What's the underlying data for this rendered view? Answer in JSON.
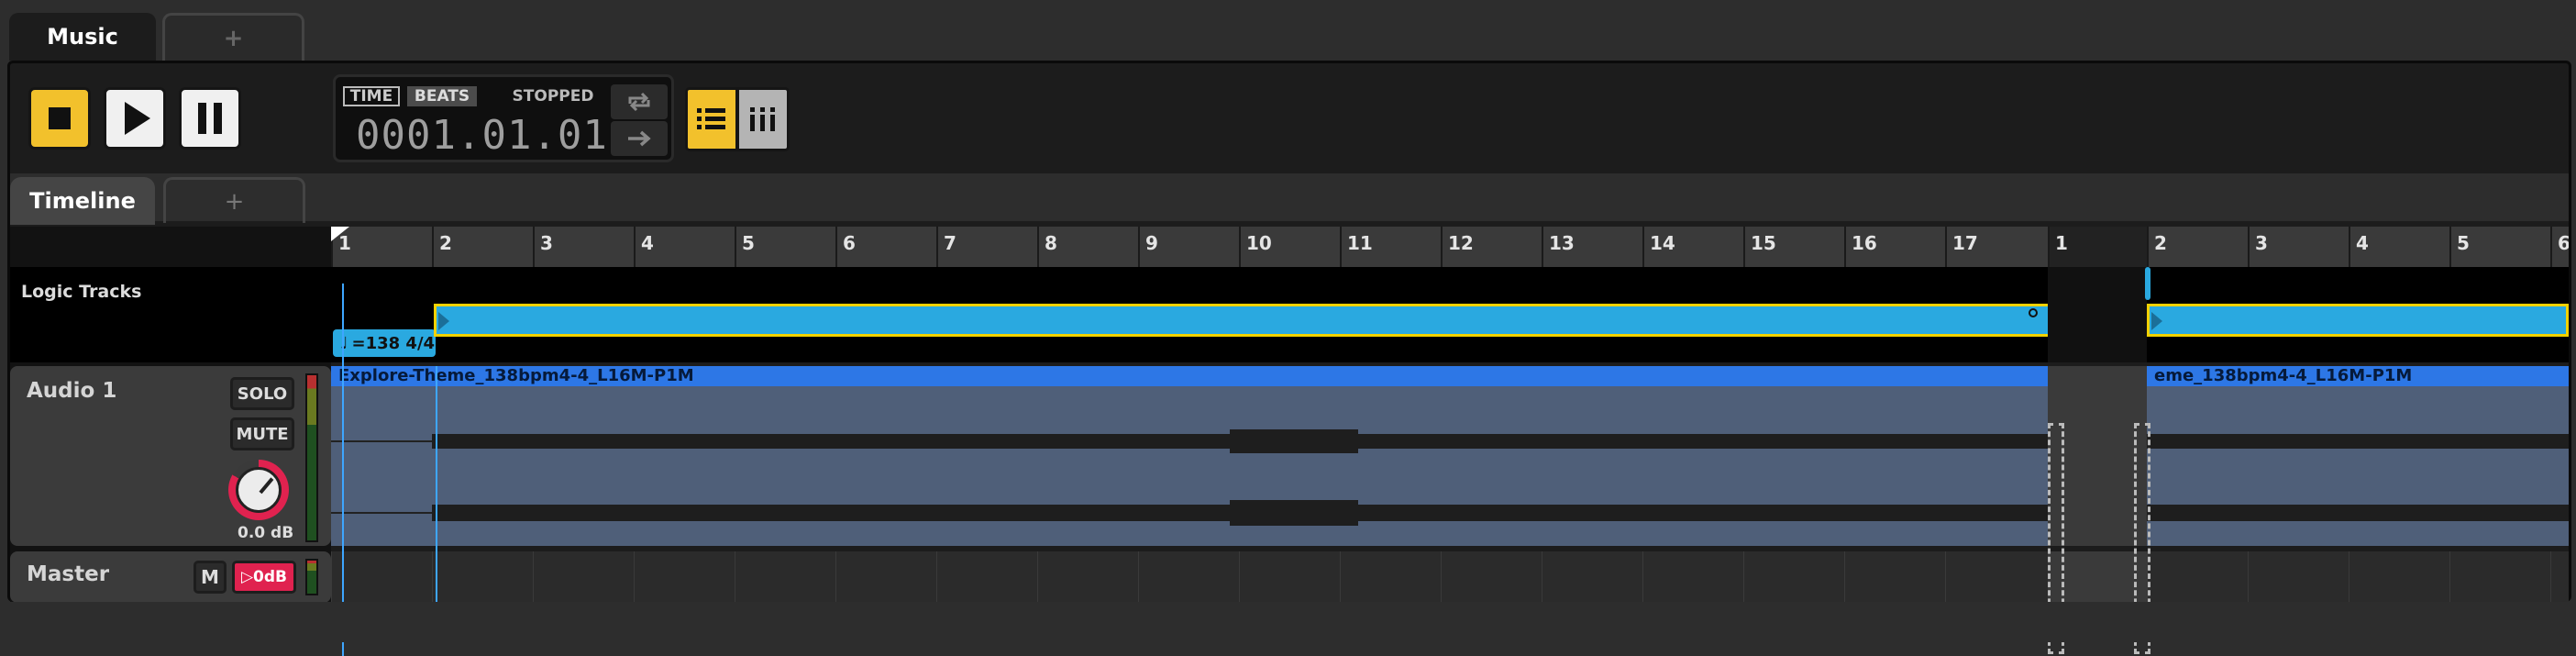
{
  "top_tabs": {
    "active": "Music",
    "add": "+"
  },
  "transport": {
    "stop_icon": "stop-icon",
    "play_icon": "play-icon",
    "pause_icon": "pause-icon",
    "time_label": "TIME",
    "beats_label": "BEATS",
    "state": "STOPPED",
    "position": "0001.01.01",
    "loop_icon": "loop-icon",
    "follow_icon": "arrow-right-icon"
  },
  "view_toggles": {
    "list_icon": "list-icon",
    "mixer_icon": "mixer-icon"
  },
  "sub_tabs": {
    "active": "Timeline",
    "add": "+"
  },
  "ruler": {
    "bars_a": [
      "1",
      "2",
      "3",
      "4",
      "5",
      "6",
      "7",
      "8",
      "9",
      "10",
      "11",
      "12",
      "13",
      "14",
      "15",
      "16",
      "17"
    ],
    "loop_marker": "1",
    "bars_b": [
      "2",
      "3",
      "4",
      "5",
      "6"
    ]
  },
  "logic_tracks": {
    "label": "Logic Tracks",
    "tempo": "=138 4/4"
  },
  "audio_track": {
    "name": "Audio 1",
    "solo": "SOLO",
    "mute": "MUTE",
    "gain": "0.0 dB",
    "clip_name_a": "Explore-Theme_138bpm4-4_L16M-P1M",
    "clip_name_b": "eme_138bpm4-4_L16M-P1M"
  },
  "master_track": {
    "name": "Master",
    "mute": "M",
    "gain": "0dB"
  },
  "colors": {
    "accent_yellow": "#f2c12c",
    "clip_blue": "#2d77e6",
    "tempo_cyan": "#2aa9e0",
    "knob_red": "#e0224f"
  }
}
